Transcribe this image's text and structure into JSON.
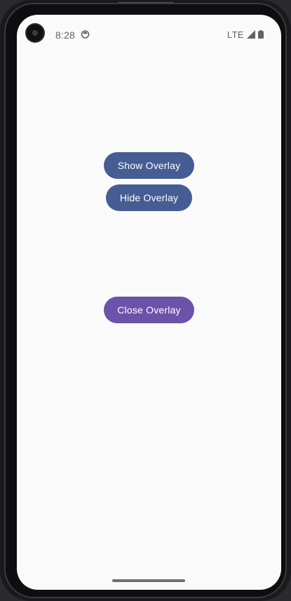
{
  "status_bar": {
    "time": "8:28",
    "network": "LTE",
    "app_icon": "android-notification-icon",
    "signal_icon": "cell-signal-icon",
    "battery_icon": "battery-icon"
  },
  "buttons": {
    "show_overlay": "Show Overlay",
    "hide_overlay": "Hide Overlay",
    "close_overlay": "Close Overlay"
  },
  "colors": {
    "primary_button": "#465d93",
    "close_button": "#6c52a9",
    "screen_background": "#fafafa"
  }
}
